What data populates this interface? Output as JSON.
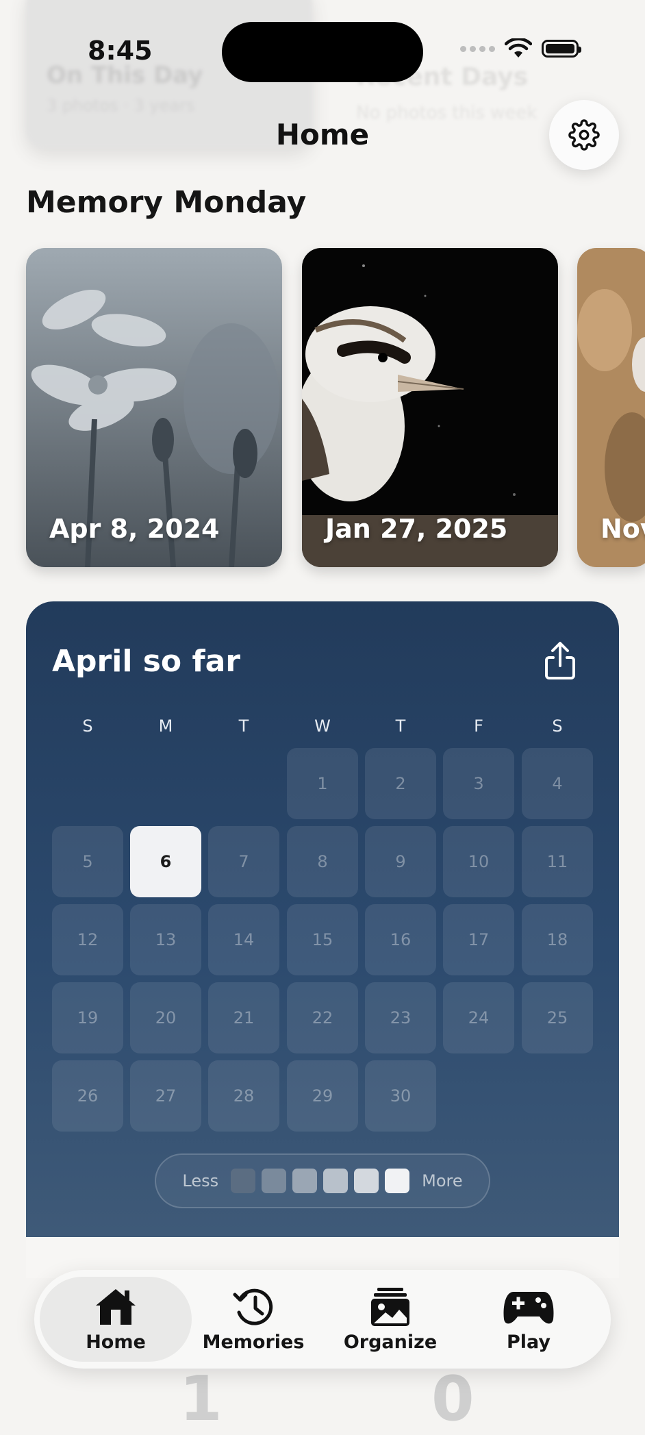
{
  "status_bar": {
    "time": "8:45"
  },
  "header": {
    "title": "Home",
    "settings_icon": "gear-icon"
  },
  "memory_section": {
    "title": "Memory Monday",
    "cards": [
      {
        "date": "Apr 8, 2024"
      },
      {
        "date": "Jan 27, 2025"
      },
      {
        "date": "Nov"
      }
    ]
  },
  "calendar": {
    "title": "April so far",
    "share_icon": "share-icon",
    "weekdays": [
      "S",
      "M",
      "T",
      "W",
      "T",
      "F",
      "S"
    ],
    "days": [
      "1",
      "2",
      "3",
      "4",
      "5",
      "6",
      "7",
      "8",
      "9",
      "10",
      "11",
      "12",
      "13",
      "14",
      "15",
      "16",
      "17",
      "18",
      "19",
      "20",
      "21",
      "22",
      "23",
      "24",
      "25",
      "26",
      "27",
      "28",
      "29",
      "30"
    ],
    "first_weekday_index": 3,
    "today": "6",
    "legend": {
      "less": "Less",
      "more": "More",
      "scale_colors": [
        "#5b6d82",
        "#7a8a9c",
        "#9aa6b4",
        "#b8c1cb",
        "#d3d8de",
        "#f1f2f4"
      ]
    }
  },
  "tabbar": {
    "tabs": [
      {
        "label": "Home",
        "icon": "house-icon",
        "active": true
      },
      {
        "label": "Memories",
        "icon": "clock-history-icon",
        "active": false
      },
      {
        "label": "Organize",
        "icon": "photo-stack-icon",
        "active": false
      },
      {
        "label": "Play",
        "icon": "gamepad-icon",
        "active": false
      }
    ]
  }
}
